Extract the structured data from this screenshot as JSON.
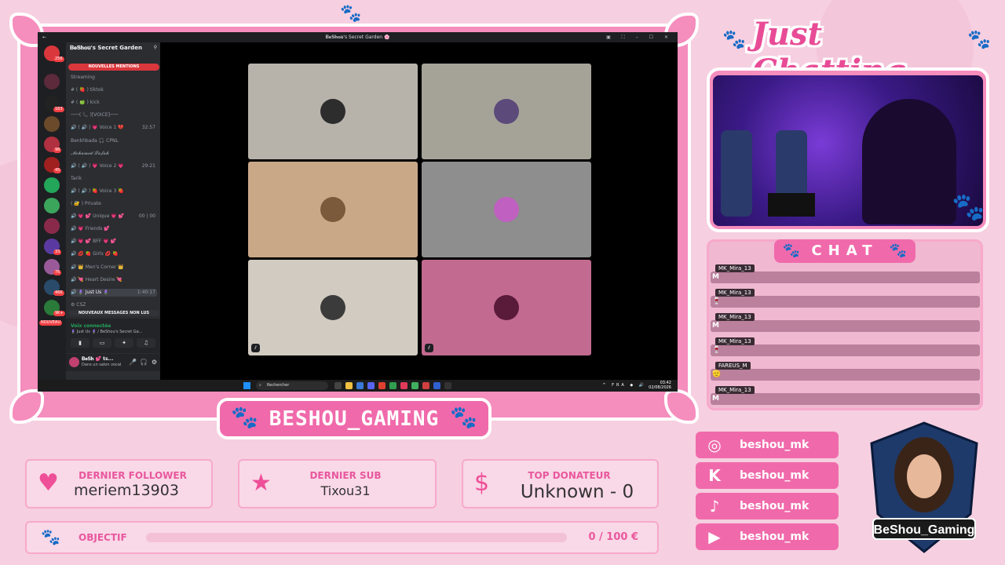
{
  "overlay": {
    "title": "Just Chatting",
    "streamer_name": "BESHOU_GAMING",
    "chat_label": "CHAT",
    "logo_text": "BeShou_Gaming",
    "colors": {
      "pink": "#f06aab",
      "light_pink": "#f9d8e7",
      "accent": "#e84c96"
    }
  },
  "discord": {
    "window_title": "𝐁𝐞𝐒𝐡𝐨𝐮's Secret Garden 🌸",
    "server_name": "𝐁𝐞𝐒𝐡𝐨𝐮's Secret Garden",
    "mentions_pill": "NOUVELLES MENTIONS",
    "unread_pill": "NOUVEAUX MESSAGES NON LUS",
    "guild_badges": [
      "256",
      "163",
      "98",
      "45",
      "33",
      "76",
      "46K",
      "9K+",
      "NOUVEAU"
    ],
    "channels": [
      {
        "label": "Streaming",
        "time": ""
      },
      {
        "label": "# ( 🍓 ) tiktok",
        "time": ""
      },
      {
        "label": "# ( 🍏 ) kick",
        "time": ""
      },
      {
        "label": "───( 📞 )[VOICE]───",
        "time": ""
      },
      {
        "label": "🔊 ( 🔊 ) 💗 Voice 1 💔",
        "time": "32:57"
      },
      {
        "label": "Benkhbada 🎧 CPNL",
        "time": ""
      },
      {
        "label": "𝓜𝓸𝓱𝓪𝓶𝓮𝓭 𝓢𝓪𝓯𝓪𝓱",
        "time": ""
      },
      {
        "label": "🔊 ( 🔊 ) 💗 Voice 2 💗",
        "time": "29:21"
      },
      {
        "label": "Tarik",
        "time": ""
      },
      {
        "label": "🔊 ( 🔊 ) 🍓 Voice 3 🍓",
        "time": ""
      },
      {
        "label": "( 🔐 ) Private",
        "time": ""
      },
      {
        "label": "🔊 💗 💕 Unique 💗 💕",
        "time": "00 | 00"
      },
      {
        "label": "🔊 💗 Friends 💕",
        "time": ""
      },
      {
        "label": "🔊 💗 💕 BFF 💗 💕",
        "time": ""
      },
      {
        "label": "🔊 💋 🍓 Girls 💋 🍓",
        "time": ""
      },
      {
        "label": "🔊 👑 Men's Corner 👑",
        "time": ""
      },
      {
        "label": "🔊 💘 Heart Desire 💘",
        "time": ""
      },
      {
        "label": "🔊 🪻 Just Us 🪻",
        "time": "1:40:17"
      },
      {
        "label": "⚙ CSZ",
        "time": ""
      }
    ],
    "voice_status": "Voix connectée",
    "voice_location": "🪻 Just Us 🪻 / BeShou's Secret Ga...",
    "user_name": "𝐁𝐞𝐒𝐡 💕 ts...",
    "user_status": "Dans un salon vocal",
    "tiles": [
      {
        "color": "#b7b3ab",
        "avatar": "#2d2d2d"
      },
      {
        "color": "#a5a398",
        "avatar": "#5b4a7a"
      },
      {
        "color": "#c9a888",
        "avatar": "#7a5a3a"
      },
      {
        "color": "#8e8e8e",
        "avatar": "#c060c0"
      },
      {
        "color": "#d1cbc1",
        "avatar": "#3b3b3b"
      },
      {
        "color": "#c26a8f",
        "avatar": "#5a1a3a"
      }
    ],
    "taskbar": {
      "search_placeholder": "Rechercher",
      "lang": "FRA",
      "time": "03:42",
      "date": "02/08/2026"
    }
  },
  "stats": {
    "follower_label": "DERNIER FOLLOWER",
    "follower_value": "meriem13903",
    "sub_label": "DERNIER SUB",
    "sub_value": "Tixou31",
    "donor_label": "TOP DONATEUR",
    "donor_value": "Unknown - 0",
    "donor_icon": "$",
    "goal_label": "OBJECTIF",
    "goal_value": "0 / 100 €",
    "goal_progress": 0
  },
  "chat": {
    "messages": [
      {
        "user": "MK_Mira_13",
        "text": "M"
      },
      {
        "user": "MK_Mira_13",
        "text": "🍷"
      },
      {
        "user": "MK_Mira_13",
        "text": "M"
      },
      {
        "user": "MK_Mira_13",
        "text": "🍷"
      },
      {
        "user": "FAREUS_M",
        "text": "🫡"
      },
      {
        "user": "MK_Mira_13",
        "text": "M"
      }
    ]
  },
  "socials": [
    {
      "icon": "instagram-icon",
      "glyph": "◎",
      "handle": "beshou_mk"
    },
    {
      "icon": "kick-icon",
      "glyph": "K",
      "handle": "beshou_mk"
    },
    {
      "icon": "tiktok-icon",
      "glyph": "♪",
      "handle": "beshou_mk"
    },
    {
      "icon": "youtube-icon",
      "glyph": "▶",
      "handle": "beshou_mk"
    }
  ]
}
